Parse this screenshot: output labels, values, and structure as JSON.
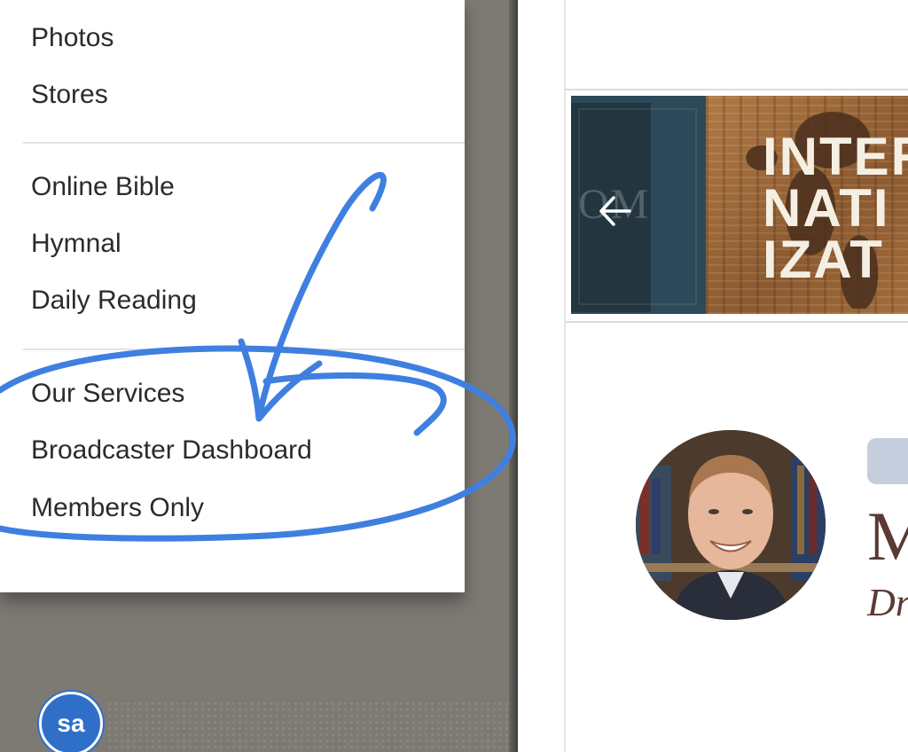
{
  "menu": {
    "group1": [
      "Photos",
      "Stores"
    ],
    "group2": [
      "Online Bible",
      "Hymnal",
      "Daily Reading"
    ],
    "group3": [
      "Our Services",
      "Broadcaster Dashboard",
      "Members Only"
    ]
  },
  "logo": {
    "text": "sa",
    "color": "#2f6fc7"
  },
  "banner": {
    "watermark": "OM",
    "headline": "INTER\nNATI\nIZAT",
    "prev_icon": "arrow-left-icon"
  },
  "profile": {
    "title_partial": "M",
    "subtitle_partial": "Dr"
  },
  "annotation": {
    "color": "#3f7fe0"
  }
}
